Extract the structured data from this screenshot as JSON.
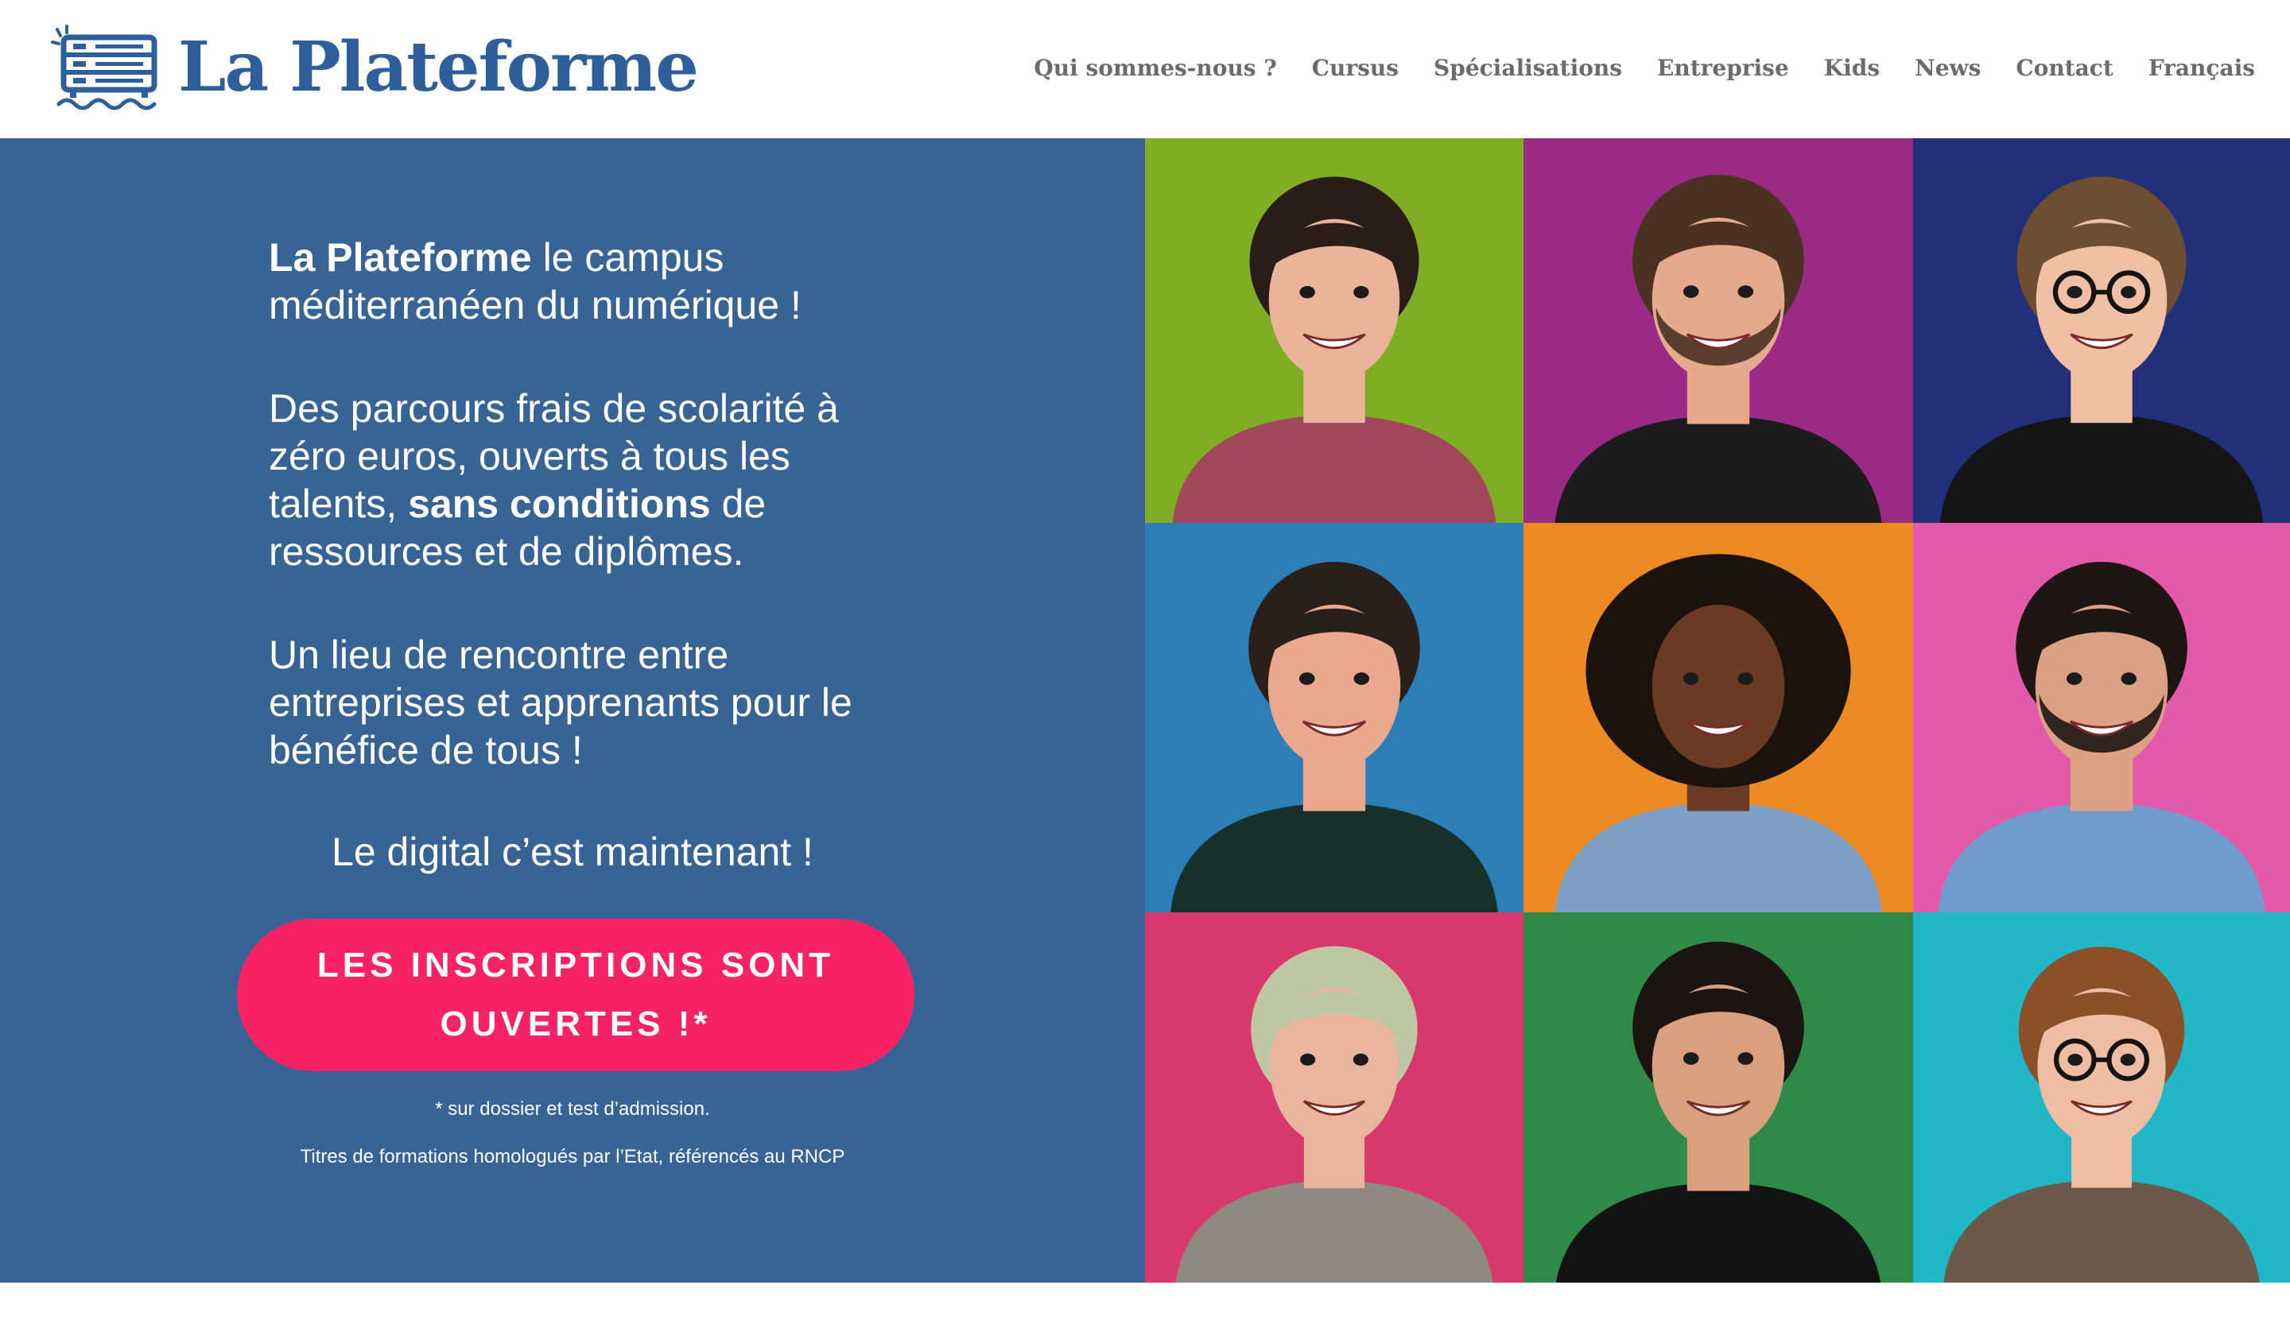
{
  "brand": {
    "name": "La Plateforme",
    "color": "#2e5f9b",
    "logo_icon": "server-rack-on-waves-icon"
  },
  "nav": {
    "items": [
      {
        "label": "Qui sommes-nous ?"
      },
      {
        "label": "Cursus"
      },
      {
        "label": "Spécialisations"
      },
      {
        "label": "Entreprise"
      },
      {
        "label": "Kids"
      },
      {
        "label": "News"
      },
      {
        "label": "Contact"
      },
      {
        "label": "Français"
      }
    ]
  },
  "hero": {
    "background_color": "#376495",
    "p1_strong": "La Plateforme",
    "p1_rest": " le campus méditerranéen du numérique !",
    "p2_start": "Des parcours frais de scolarité à zéro euros, ouverts à tous les talents, ",
    "p2_strong": "sans conditions",
    "p2_end": " de ressources et de diplômes.",
    "p3": "Un lieu de rencontre entre entreprises et apprenants pour le bénéfice de tous !",
    "tagline": "Le digital c’est maintenant !",
    "cta_label": "LES INSCRIPTIONS SONT OUVERTES !*",
    "cta_color": "#f72366",
    "note1": "* sur dossier et test d’admission.",
    "note2": "Titres de formations homologués par l’Etat, référencés au RNCP"
  },
  "photos": [
    {
      "bg": "#7fae24",
      "skin": "#e9b49a",
      "hair": "#2a1c16",
      "shirt": "#a0475a",
      "glasses": false,
      "beard": false
    },
    {
      "bg": "#9a2a86",
      "skin": "#e5a98c",
      "hair": "#4a3122",
      "shirt": "#1c1c1c",
      "glasses": false,
      "beard": true
    },
    {
      "bg": "#22307a",
      "skin": "#efc0a4",
      "hair": "#6e4e31",
      "shirt": "#151515",
      "glasses": true,
      "beard": false
    },
    {
      "bg": "#2b7eb6",
      "skin": "#eaa98e",
      "hair": "#2a2019",
      "shirt": "#17312a",
      "glasses": false,
      "beard": false
    },
    {
      "bg": "#ed8a24",
      "skin": "#6a3a22",
      "hair": "#1b120c",
      "shirt": "#7ea0c6",
      "glasses": false,
      "beard": false
    },
    {
      "bg": "#e35aab",
      "skin": "#dca082",
      "hair": "#1e1612",
      "shirt": "#6f9ccc",
      "glasses": false,
      "beard": true
    },
    {
      "bg": "#d7386e",
      "skin": "#eab59d",
      "hair": "#bfc6a2",
      "shirt": "#8e8a80",
      "glasses": false,
      "beard": false
    },
    {
      "bg": "#2f8a4a",
      "skin": "#d9a07e",
      "hair": "#1b1410",
      "shirt": "#131313",
      "glasses": false,
      "beard": false
    },
    {
      "bg": "#21b7c6",
      "skin": "#eebda4",
      "hair": "#8b4f2a",
      "shirt": "#6b5a4c",
      "glasses": true,
      "beard": false
    }
  ]
}
